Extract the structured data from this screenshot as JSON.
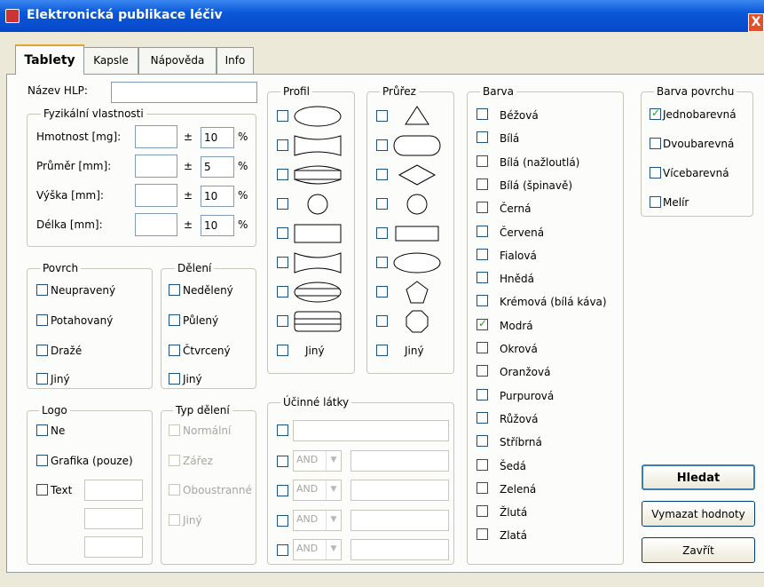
{
  "window": {
    "title": "Elektronická publikace léčiv",
    "close_glyph": "X"
  },
  "tabs": [
    {
      "label": "Tablety",
      "active": true
    },
    {
      "label": "Kapsle",
      "active": false
    },
    {
      "label": "Nápověda",
      "active": false
    },
    {
      "label": "Info",
      "active": false
    }
  ],
  "name_field": {
    "label": "Název HLP:",
    "value": ""
  },
  "physical": {
    "title": "Fyzikální vlastnosti",
    "pm": "±",
    "percent": "%",
    "rows": [
      {
        "label": "Hmotnost [mg]:",
        "value": "",
        "tolerance": "10"
      },
      {
        "label": "Průměr [mm]:",
        "value": "",
        "tolerance": "5"
      },
      {
        "label": "Výška [mm]:",
        "value": "",
        "tolerance": "10"
      },
      {
        "label": "Délka [mm]:",
        "value": "",
        "tolerance": "10"
      }
    ]
  },
  "surface": {
    "title": "Povrch",
    "items": [
      "Neupravený",
      "Potahovaný",
      "Dražé",
      "Jiný"
    ]
  },
  "division": {
    "title": "Dělení",
    "items": [
      "Nedělený",
      "Půlený",
      "Čtvrcený",
      "Jiný"
    ]
  },
  "logo": {
    "title": "Logo",
    "items": [
      "Ne",
      "Grafika (pouze)",
      "Text"
    ]
  },
  "division_type": {
    "title": "Typ dělení",
    "items": [
      "Normální",
      "Zářez",
      "Oboustranné",
      "Jiný"
    ]
  },
  "profile": {
    "title": "Profil",
    "other_label": "Jiný"
  },
  "cross_section": {
    "title": "Průřez",
    "other_label": "Jiný"
  },
  "active_ingredients": {
    "title": "Účinné látky",
    "operator": "AND",
    "rows": 4
  },
  "colour": {
    "title": "Barva",
    "items": [
      {
        "label": "Béžová",
        "checked": false
      },
      {
        "label": "Bílá",
        "checked": false
      },
      {
        "label": "Bílá (nažloutlá)",
        "checked": false
      },
      {
        "label": "Bílá (špinavě)",
        "checked": false
      },
      {
        "label": "Černá",
        "checked": false
      },
      {
        "label": "Červená",
        "checked": false
      },
      {
        "label": "Fialová",
        "checked": false
      },
      {
        "label": "Hnědá",
        "checked": false
      },
      {
        "label": "Krémová (bílá káva)",
        "checked": false
      },
      {
        "label": "Modrá",
        "checked": true
      },
      {
        "label": "Okrová",
        "checked": false
      },
      {
        "label": "Oranžová",
        "checked": false
      },
      {
        "label": "Purpurová",
        "checked": false
      },
      {
        "label": "Růžová",
        "checked": false
      },
      {
        "label": "Stříbrná",
        "checked": false
      },
      {
        "label": "Šedá",
        "checked": false
      },
      {
        "label": "Zelená",
        "checked": false
      },
      {
        "label": "Žlutá",
        "checked": false
      },
      {
        "label": "Zlatá",
        "checked": false
      }
    ]
  },
  "surface_colour": {
    "title": "Barva povrchu",
    "items": [
      {
        "label": "Jednobarevná",
        "checked": true
      },
      {
        "label": "Dvoubarevná",
        "checked": false
      },
      {
        "label": "Vícebarevná",
        "checked": false
      },
      {
        "label": "Melír",
        "checked": false
      }
    ]
  },
  "buttons": {
    "search": "Hledat",
    "clear": "Vymazat hodnoty",
    "close": "Zavřít"
  },
  "colors": {
    "titlebar": "#0a58d8",
    "checkbox_border": "#1c5180",
    "check": "#21a121",
    "tab_highlight": "#e8a22a"
  }
}
